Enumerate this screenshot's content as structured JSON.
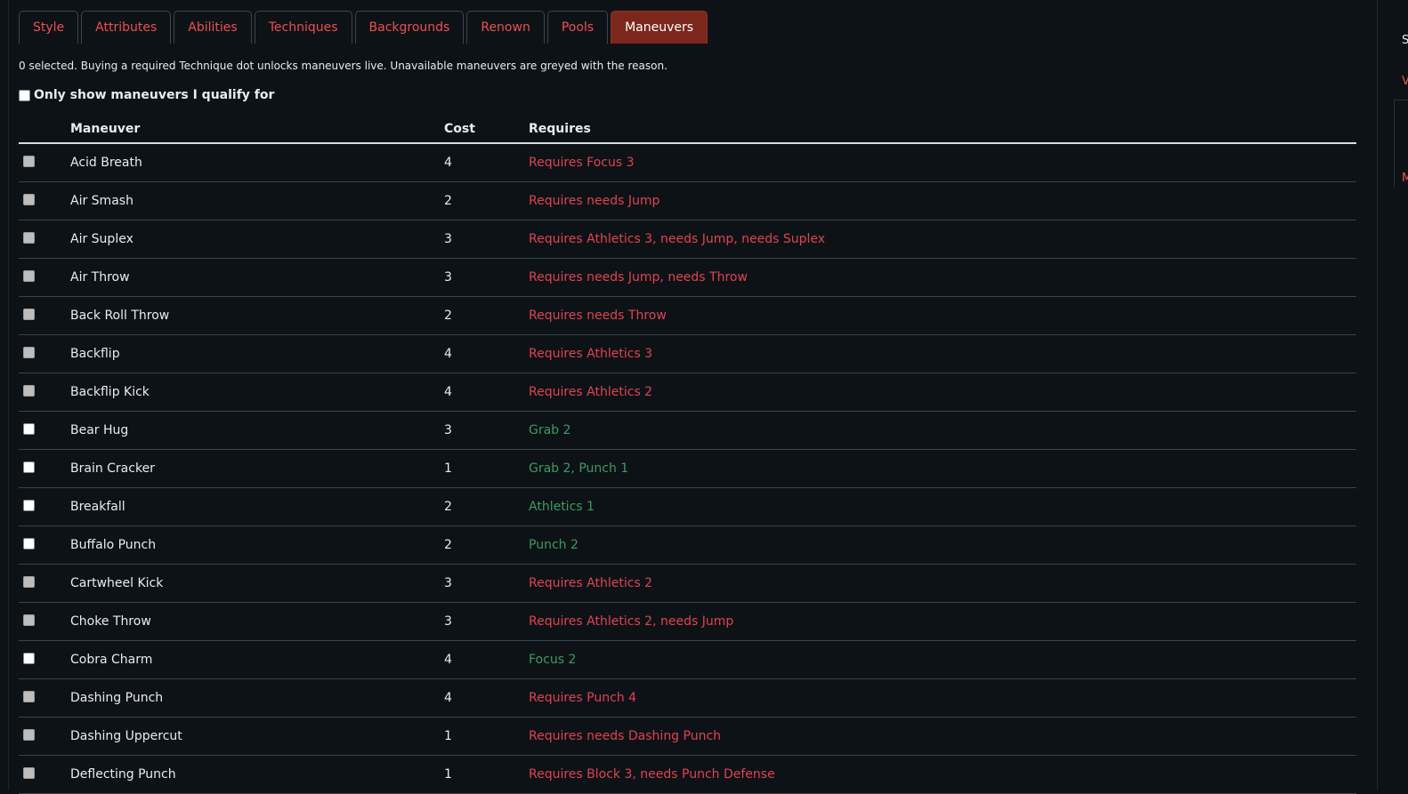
{
  "tabs": [
    {
      "label": "Style",
      "active": false
    },
    {
      "label": "Attributes",
      "active": false
    },
    {
      "label": "Abilities",
      "active": false
    },
    {
      "label": "Techniques",
      "active": false
    },
    {
      "label": "Backgrounds",
      "active": false
    },
    {
      "label": "Renown",
      "active": false
    },
    {
      "label": "Pools",
      "active": false
    },
    {
      "label": "Maneuvers",
      "active": true
    }
  ],
  "info_text": "0 selected. Buying a required Technique dot unlocks maneuvers live. Unavailable maneuvers are greyed with the reason.",
  "filter": {
    "label": "Only show maneuvers I qualify for",
    "checked": false
  },
  "table": {
    "headers": {
      "maneuver": "Maneuver",
      "cost": "Cost",
      "requires": "Requires"
    },
    "rows": [
      {
        "name": "Acid Breath",
        "cost": "4",
        "requires": "Requires Focus 3",
        "available": false
      },
      {
        "name": "Air Smash",
        "cost": "2",
        "requires": "Requires needs Jump",
        "available": false
      },
      {
        "name": "Air Suplex",
        "cost": "3",
        "requires": "Requires Athletics 3, needs Jump, needs Suplex",
        "available": false
      },
      {
        "name": "Air Throw",
        "cost": "3",
        "requires": "Requires needs Jump, needs Throw",
        "available": false
      },
      {
        "name": "Back Roll Throw",
        "cost": "2",
        "requires": "Requires needs Throw",
        "available": false
      },
      {
        "name": "Backflip",
        "cost": "4",
        "requires": "Requires Athletics 3",
        "available": false
      },
      {
        "name": "Backflip Kick",
        "cost": "4",
        "requires": "Requires Athletics 2",
        "available": false
      },
      {
        "name": "Bear Hug",
        "cost": "3",
        "requires": "Grab 2",
        "available": true
      },
      {
        "name": "Brain Cracker",
        "cost": "1",
        "requires": "Grab 2, Punch 1",
        "available": true
      },
      {
        "name": "Breakfall",
        "cost": "2",
        "requires": "Athletics 1",
        "available": true
      },
      {
        "name": "Buffalo Punch",
        "cost": "2",
        "requires": "Punch 2",
        "available": true
      },
      {
        "name": "Cartwheel Kick",
        "cost": "3",
        "requires": "Requires Athletics 2",
        "available": false
      },
      {
        "name": "Choke Throw",
        "cost": "3",
        "requires": "Requires Athletics 2, needs Jump",
        "available": false
      },
      {
        "name": "Cobra Charm",
        "cost": "4",
        "requires": "Focus 2",
        "available": true
      },
      {
        "name": "Dashing Punch",
        "cost": "4",
        "requires": "Requires Punch 4",
        "available": false
      },
      {
        "name": "Dashing Uppercut",
        "cost": "1",
        "requires": "Requires needs Dashing Punch",
        "available": false
      },
      {
        "name": "Deflecting Punch",
        "cost": "1",
        "requires": "Requires Block 3, needs Punch Defense",
        "available": false
      }
    ]
  },
  "side_panel": {
    "line1": "S",
    "line2": "V",
    "line3": "M"
  },
  "colors": {
    "background": "#0d1217",
    "active_tab": "#7b271c",
    "tab_text": "#ee4f4f",
    "unavailable": "#e0434f",
    "available": "#3f9a5e"
  }
}
